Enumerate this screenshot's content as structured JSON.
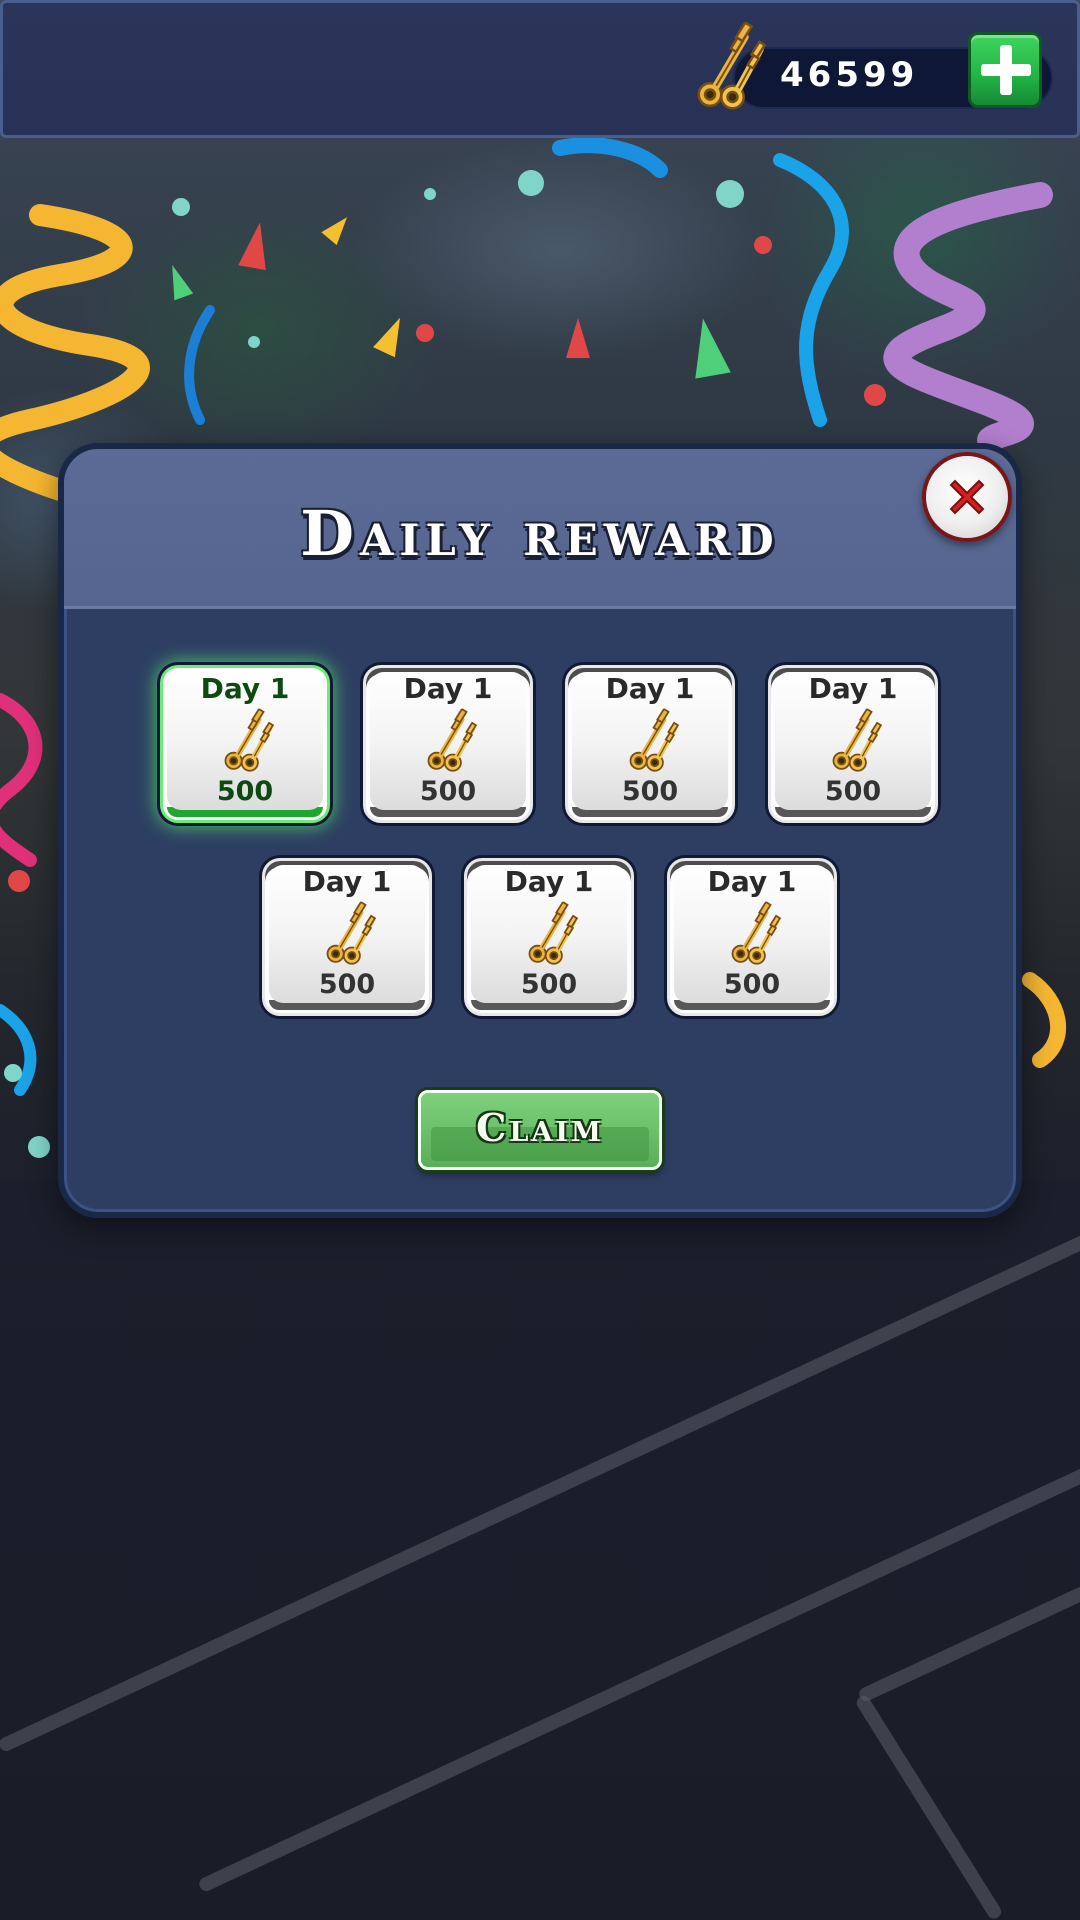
{
  "topbar": {
    "currency_amount": "46599",
    "currency_icon": "golden-keys-icon",
    "add_button_icon": "plus-icon"
  },
  "dialog": {
    "title": "Daily reward",
    "close_icon": "close-icon",
    "days": [
      {
        "label": "Day 1",
        "amount": "500",
        "state": "active"
      },
      {
        "label": "Day 1",
        "amount": "500",
        "state": "locked"
      },
      {
        "label": "Day 1",
        "amount": "500",
        "state": "locked"
      },
      {
        "label": "Day 1",
        "amount": "500",
        "state": "locked"
      },
      {
        "label": "Day 1",
        "amount": "500",
        "state": "locked"
      },
      {
        "label": "Day 1",
        "amount": "500",
        "state": "locked"
      },
      {
        "label": "Day 1",
        "amount": "500",
        "state": "locked"
      }
    ],
    "claim_label": "Claim"
  },
  "colors": {
    "accent_green": "#3fd45e",
    "dialog_bg": "#2d3e62",
    "header_bg": "#5b6b96",
    "close_red": "#d62020",
    "key_gold": "#e0ae3a"
  }
}
